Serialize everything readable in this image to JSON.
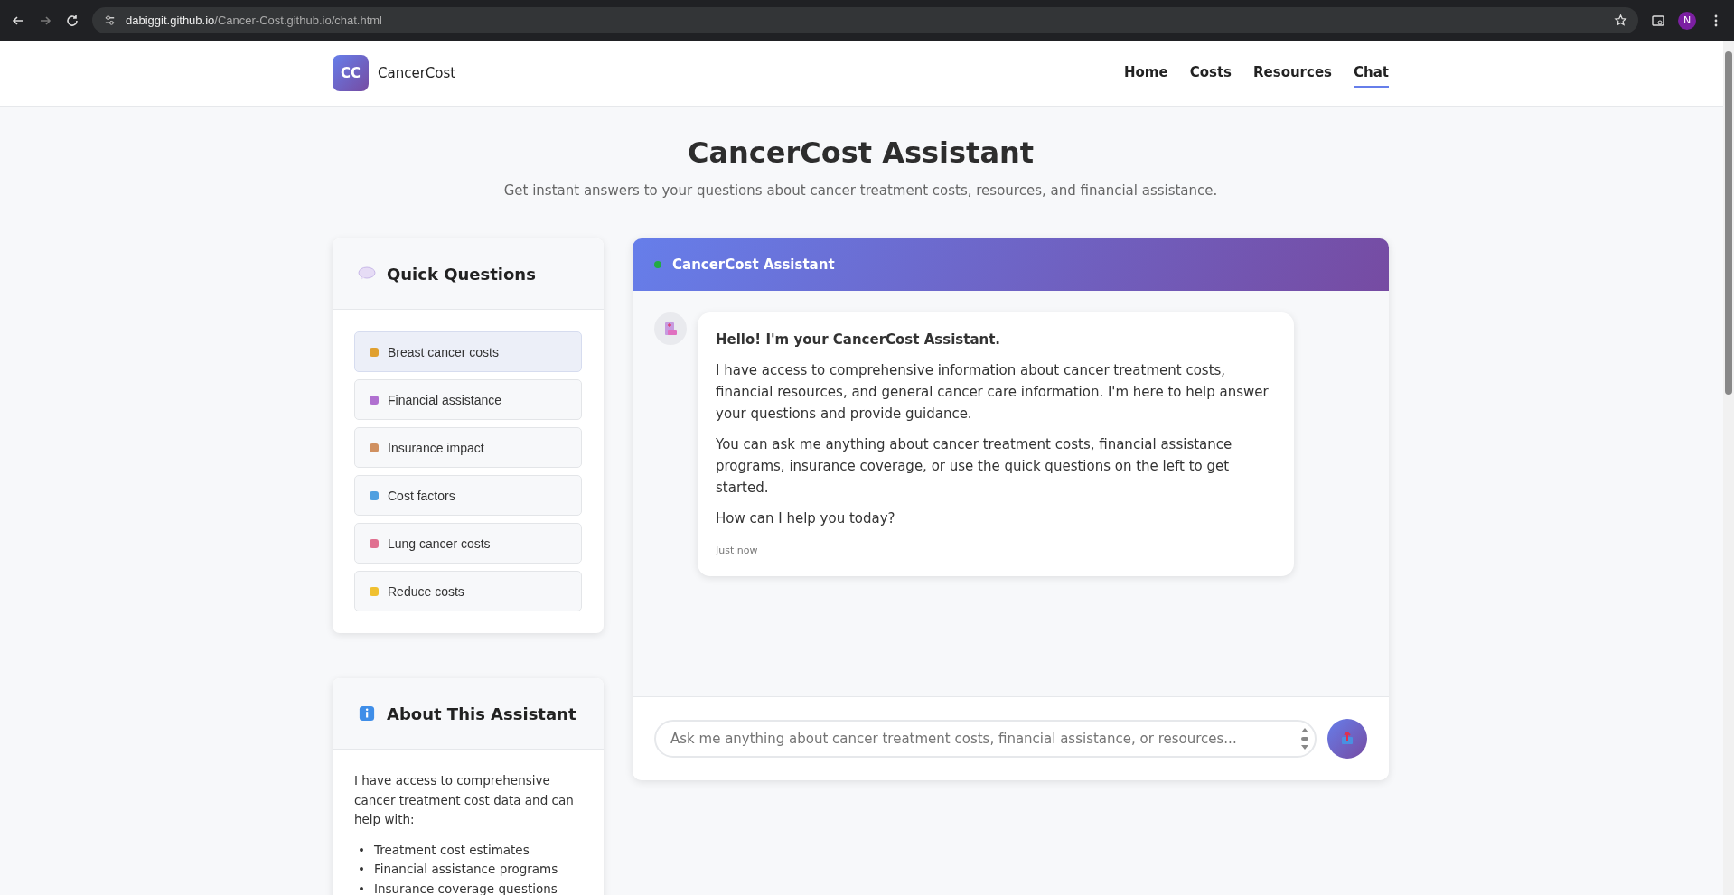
{
  "browser": {
    "url_host": "dabiggit.github.io",
    "url_path": "/Cancer-Cost.github.io/chat.html",
    "profile_initial": "N"
  },
  "header": {
    "logo_mark": "CC",
    "brand": "CancerCost",
    "nav": [
      {
        "label": "Home",
        "selected": false
      },
      {
        "label": "Costs",
        "selected": false
      },
      {
        "label": "Resources",
        "selected": false
      },
      {
        "label": "Chat",
        "selected": true
      }
    ]
  },
  "page": {
    "title": "CancerCost Assistant",
    "subtitle": "Get instant answers to your questions about cancer treatment costs, resources, and financial assistance."
  },
  "quick_questions": {
    "title": "Quick Questions",
    "items": [
      {
        "label": "Breast cancer costs",
        "selected": true
      },
      {
        "label": "Financial assistance",
        "selected": false
      },
      {
        "label": "Insurance impact",
        "selected": false
      },
      {
        "label": "Cost factors",
        "selected": false
      },
      {
        "label": "Lung cancer costs",
        "selected": false
      },
      {
        "label": "Reduce costs",
        "selected": false
      }
    ]
  },
  "about": {
    "title": "About This Assistant",
    "intro": "I have access to comprehensive cancer treatment cost data and can help with:",
    "bullets": [
      {
        "marker": "•",
        "text": "Treatment cost estimates"
      },
      {
        "marker": "•",
        "text": "Financial assistance programs"
      },
      {
        "marker": "•",
        "text": "Insurance coverage questions"
      }
    ]
  },
  "chat": {
    "title": "CancerCost Assistant",
    "online": true,
    "messages": [
      {
        "heading": "Hello! I'm your CancerCost Assistant.",
        "paragraphs": [
          "I have access to comprehensive information about cancer treatment costs, financial resources, and general cancer care information. I'm here to help answer your questions and provide guidance.",
          "You can ask me anything about cancer treatment costs, financial assistance programs, insurance coverage, or use the quick questions on the left to get started.",
          "How can I help you today?"
        ],
        "time": "Just now"
      }
    ],
    "input": {
      "placeholder": "Ask me anything about cancer treatment costs, financial assistance, or resources..."
    }
  }
}
